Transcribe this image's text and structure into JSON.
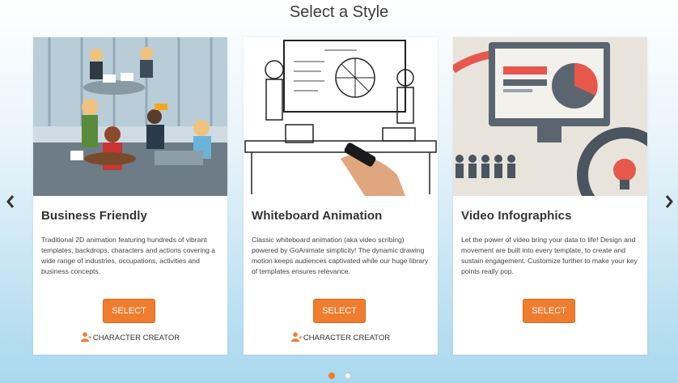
{
  "page": {
    "title": "Select a Style"
  },
  "colors": {
    "accent": "#f07c2e",
    "background_bottom": "#a9d8ee"
  },
  "nav": {
    "prev_icon": "chevron-left-icon",
    "next_icon": "chevron-right-icon"
  },
  "cards": [
    {
      "title": "Business Friendly",
      "description": "Traditional 2D animation featuring hundreds of vibrant templates, backdrops, characters and actions covering a wide range of industries, occupations, activities and business concepts.",
      "select_label": "SELECT",
      "creator_label": "CHARACTER CREATOR",
      "creator_icon": "add-user-icon"
    },
    {
      "title": "Whiteboard Animation",
      "description": "Classic whiteboard animation (aka video scribing) powered by GoAnimate simplicity! The dynamic drawing motion keeps audiences captivated while our huge library of templates ensures relevance.",
      "select_label": "SELECT",
      "creator_label": "CHARACTER CREATOR",
      "creator_icon": "add-user-icon"
    },
    {
      "title": "Video Infographics",
      "description": "Let the power of video bring your data to life! Design and movement are built into every template, to create and sustain engagement. Customize further to make your key points really pop.",
      "select_label": "SELECT"
    }
  ],
  "pagination": {
    "current": 1,
    "total": 2
  }
}
